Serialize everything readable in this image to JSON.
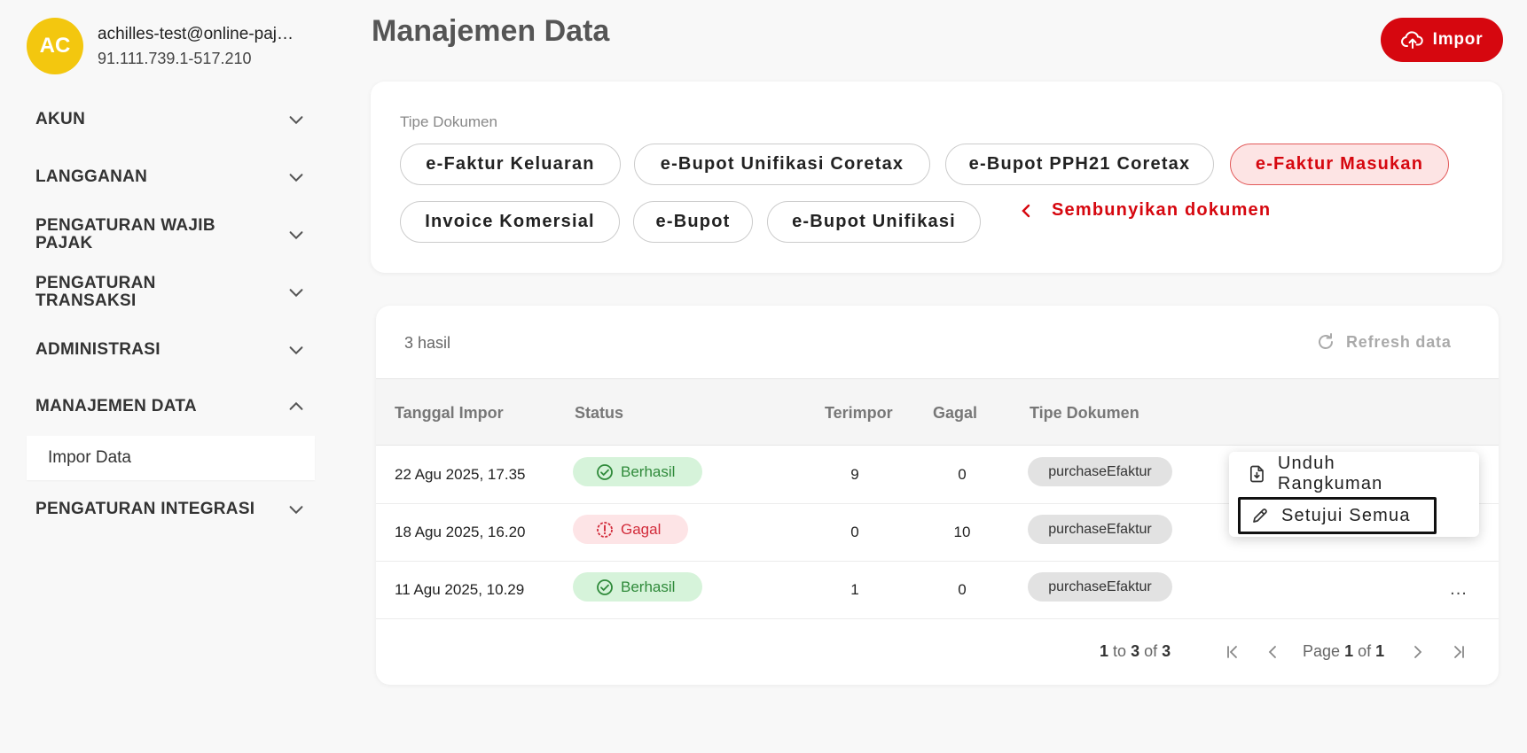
{
  "profile": {
    "initials": "AC",
    "email": "achilles-test@online-pajak.com",
    "taxid": "91.111.739.1-517.210"
  },
  "nav": [
    {
      "label": "AKUN",
      "expanded": false
    },
    {
      "label": "LANGGANAN",
      "expanded": false
    },
    {
      "label": "PENGATURAN WAJIB PAJAK",
      "expanded": false
    },
    {
      "label": "PENGATURAN TRANSAKSI",
      "expanded": false
    },
    {
      "label": "ADMINISTRASI",
      "expanded": false
    },
    {
      "label": "MANAJEMEN DATA",
      "expanded": true,
      "sub": [
        "Impor Data"
      ]
    },
    {
      "label": "PENGATURAN INTEGRASI",
      "expanded": false
    }
  ],
  "header": {
    "title": "Manajemen Data",
    "impor_label": "Impor"
  },
  "filters": {
    "label": "Tipe Dokumen",
    "chips": [
      {
        "label": "e-Faktur Keluaran",
        "active": false
      },
      {
        "label": "e-Bupot Unifikasi Coretax",
        "active": false
      },
      {
        "label": "e-Bupot PPH21 Coretax",
        "active": false
      },
      {
        "label": "e-Faktur Masukan",
        "active": true
      },
      {
        "label": "Invoice Komersial",
        "active": false
      },
      {
        "label": "e-Bupot",
        "active": false
      },
      {
        "label": "e-Bupot Unifikasi",
        "active": false
      }
    ],
    "hide_label": "Sembunyikan dokumen"
  },
  "table": {
    "results": "3 hasil",
    "refresh_label": "Refresh data",
    "columns": [
      "Tanggal Impor",
      "Status",
      "Terimpor",
      "Gagal",
      "Tipe Dokumen"
    ],
    "rows": [
      {
        "date": "22 Agu 2025, 17.35",
        "status": "Berhasil",
        "status_type": "ok",
        "imported": "9",
        "failed": "0",
        "doctype": "purchaseEfaktur"
      },
      {
        "date": "18 Agu 2025, 16.20",
        "status": "Gagal",
        "status_type": "fail",
        "imported": "0",
        "failed": "10",
        "doctype": "purchaseEfaktur"
      },
      {
        "date": "11 Agu 2025, 10.29",
        "status": "Berhasil",
        "status_type": "ok",
        "imported": "1",
        "failed": "0",
        "doctype": "purchaseEfaktur"
      }
    ],
    "more_label": "...",
    "pager": {
      "from": "1",
      "to": "3",
      "of": "3",
      "to_word": "to",
      "of_word": "of",
      "page_word": "Page",
      "page": "1",
      "pages": "1"
    }
  },
  "menu": {
    "items": [
      "Unduh Rangkuman",
      "Setujui Semua"
    ]
  },
  "colors": {
    "brand": "#d6070f",
    "avatar": "#f3c70f",
    "success": "#2f8a3a",
    "danger": "#d22b3a"
  }
}
